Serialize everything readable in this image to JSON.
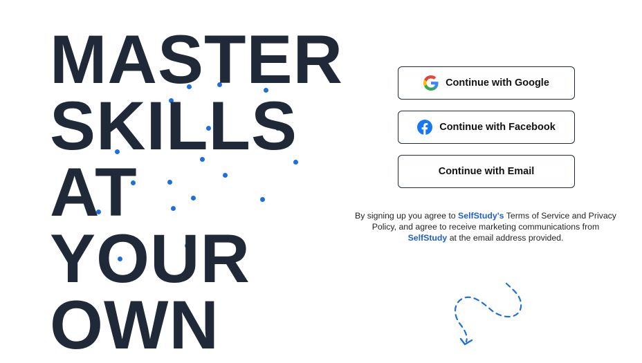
{
  "hero": {
    "headline_lines": [
      "MASTER",
      "SKILLS",
      "AT",
      "YOUR",
      "OWN"
    ]
  },
  "auth": {
    "google_label": "Continue with Google",
    "facebook_label": "Continue with Facebook",
    "email_label": "Continue with Email"
  },
  "terms": {
    "part1": "By signing up you agree to ",
    "brand1": "SelfStudy's",
    "part2": " Terms of Service and Privacy Policy, and agree to receive marketing communications from ",
    "brand2": "SelfStudy",
    "part3": " at the email address provided."
  },
  "colors": {
    "headline": "#1f2937",
    "accent": "#1d6fe0",
    "brand_text": "#1d5fd0"
  },
  "icons": {
    "google": "google-g-icon",
    "facebook": "facebook-f-icon",
    "decor": "dashed-swirl-arrow-icon"
  }
}
